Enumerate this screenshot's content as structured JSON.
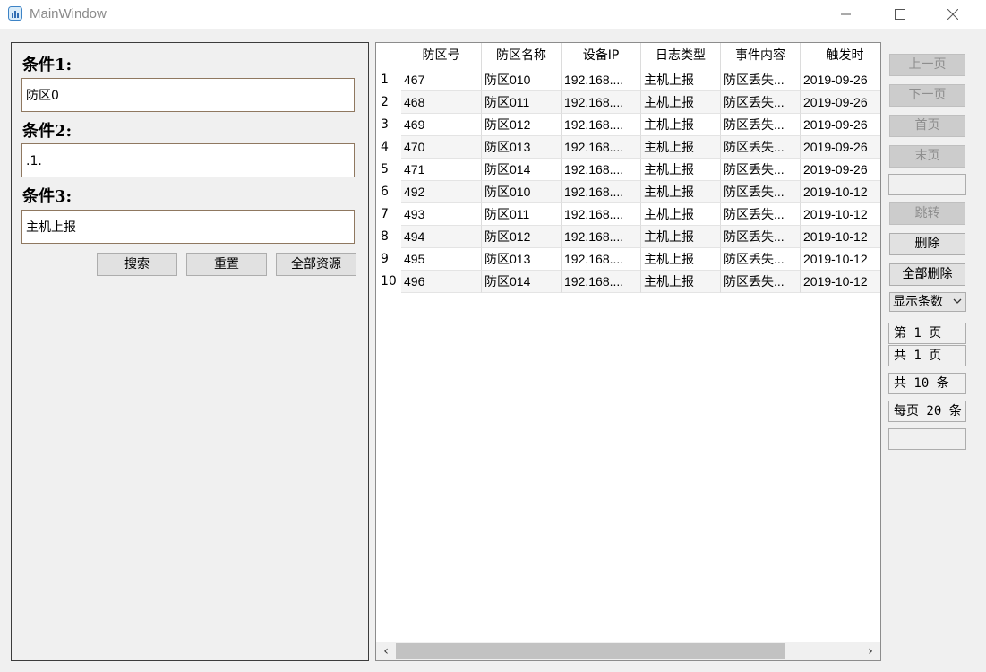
{
  "window": {
    "title": "MainWindow",
    "icon": "chart-app-icon"
  },
  "filters": {
    "cond1": {
      "label": "条件1:",
      "value": "防区0"
    },
    "cond2": {
      "label": "条件2:",
      "value": ".1."
    },
    "cond3": {
      "label": "条件3:",
      "value": "主机上报"
    },
    "buttons": {
      "search": "搜索",
      "reset": "重置",
      "all": "全部资源"
    }
  },
  "table": {
    "columns": [
      "防区号",
      "防区名称",
      "设备IP",
      "日志类型",
      "事件内容",
      "触发时"
    ],
    "rows": [
      {
        "n": "1",
        "cells": [
          "467",
          "防区010",
          "192.168....",
          "主机上报",
          "防区丢失...",
          "2019-09-26"
        ]
      },
      {
        "n": "2",
        "cells": [
          "468",
          "防区011",
          "192.168....",
          "主机上报",
          "防区丢失...",
          "2019-09-26"
        ]
      },
      {
        "n": "3",
        "cells": [
          "469",
          "防区012",
          "192.168....",
          "主机上报",
          "防区丢失...",
          "2019-09-26"
        ]
      },
      {
        "n": "4",
        "cells": [
          "470",
          "防区013",
          "192.168....",
          "主机上报",
          "防区丢失...",
          "2019-09-26"
        ]
      },
      {
        "n": "5",
        "cells": [
          "471",
          "防区014",
          "192.168....",
          "主机上报",
          "防区丢失...",
          "2019-09-26"
        ]
      },
      {
        "n": "6",
        "cells": [
          "492",
          "防区010",
          "192.168....",
          "主机上报",
          "防区丢失...",
          "2019-10-12"
        ]
      },
      {
        "n": "7",
        "cells": [
          "493",
          "防区011",
          "192.168....",
          "主机上报",
          "防区丢失...",
          "2019-10-12"
        ]
      },
      {
        "n": "8",
        "cells": [
          "494",
          "防区012",
          "192.168....",
          "主机上报",
          "防区丢失...",
          "2019-10-12"
        ]
      },
      {
        "n": "9",
        "cells": [
          "495",
          "防区013",
          "192.168....",
          "主机上报",
          "防区丢失...",
          "2019-10-12"
        ]
      },
      {
        "n": "10",
        "cells": [
          "496",
          "防区014",
          "192.168....",
          "主机上报",
          "防区丢失...",
          "2019-10-12"
        ]
      }
    ]
  },
  "pager": {
    "prev": "上一页",
    "next": "下一页",
    "first": "首页",
    "last": "末页",
    "jump_input": "",
    "jump": "跳转",
    "delete": "删除",
    "delete_all": "全部删除",
    "page_size_select": "显示条数",
    "current_page": "第 1 页",
    "total_pages": "共 1 页",
    "total_records": "共 10 条",
    "per_page": "每页 20 条",
    "blank_box": ""
  },
  "colors": {
    "row_alt": "#f5f5f5",
    "row": "#ffffff",
    "disabled_btn": "#cccccc",
    "input_border": "#8f7860"
  }
}
